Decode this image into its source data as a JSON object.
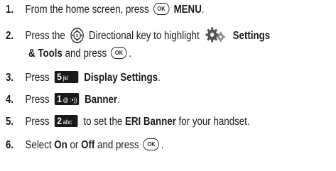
{
  "steps": [
    {
      "number": "1.",
      "text_before": "From the home screen, press",
      "ok_label": "OK",
      "bold": "MENU",
      "text_after": "."
    },
    {
      "number": "2.",
      "text_before": "Press the",
      "text_mid": "Directional key to highlight",
      "bold_a": "Settings",
      "bold_b": "& Tools",
      "text_after": "and press",
      "ok_label": "OK",
      "period": "."
    },
    {
      "number": "3.",
      "text_before": "Press",
      "key_digit": "5",
      "key_letters": "jkl",
      "bold": "Display Settings",
      "text_after": "."
    },
    {
      "number": "4.",
      "text_before": "Press",
      "key_digit": "1",
      "key_letters": "@ :•))",
      "bold": "Banner",
      "text_after": "."
    },
    {
      "number": "5.",
      "text_before": "Press",
      "key_digit": "2",
      "key_letters": "abc",
      "text_mid": "to set the",
      "bold": "ERI Banner",
      "text_after": "for your handset."
    },
    {
      "number": "6.",
      "text_before": "Select",
      "bold_a": "On",
      "text_mid": "or",
      "bold_b": "Off",
      "text_after": "and press",
      "ok_label": "OK",
      "period": "."
    }
  ],
  "icons": {
    "ok": "ok-key-icon",
    "directional": "directional-key-icon",
    "settings": "settings-tools-gear-icon",
    "key5": "keypad-5-icon",
    "key1": "keypad-1-icon",
    "key2": "keypad-2-icon"
  }
}
